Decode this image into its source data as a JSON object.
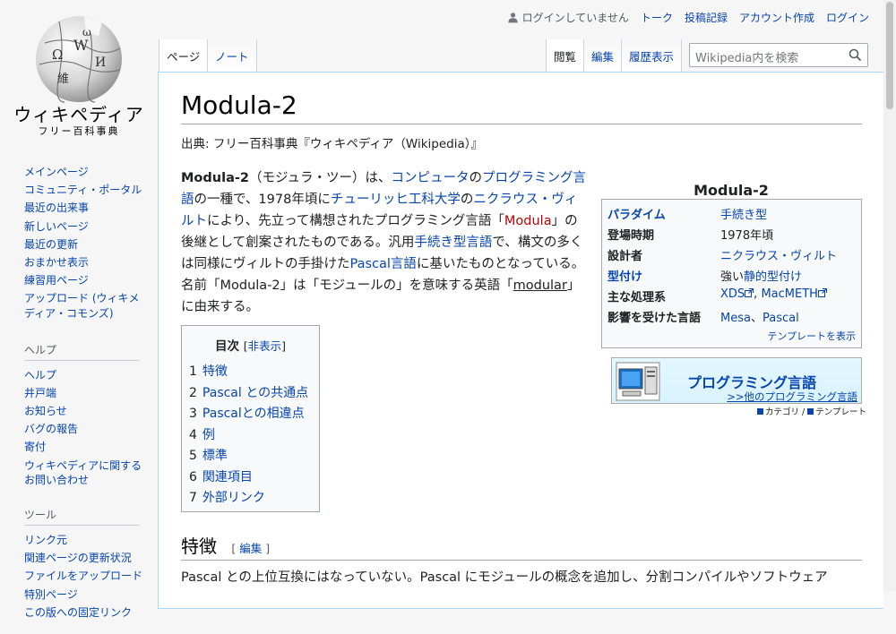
{
  "logo": {
    "name": "ウィキペディア",
    "tagline": "フリー百科事典"
  },
  "personal": {
    "status": "ログインしていません",
    "links": [
      "トーク",
      "投稿記録",
      "アカウント作成",
      "ログイン"
    ]
  },
  "tabs": {
    "left": [
      "ページ",
      "ノート"
    ],
    "right": [
      "閲覧",
      "編集",
      "履歴表示"
    ]
  },
  "search": {
    "placeholder": "Wikipedia内を検索"
  },
  "sidebar": {
    "nav": [
      "メインページ",
      "コミュニティ・ポータル",
      "最近の出来事",
      "新しいページ",
      "最近の更新",
      "おまかせ表示",
      "練習用ページ",
      "アップロード (ウィキメディア・コモンズ)"
    ],
    "help_heading": "ヘルプ",
    "help": [
      "ヘルプ",
      "井戸端",
      "お知らせ",
      "バグの報告",
      "寄付",
      "ウィキペディアに関するお問い合わせ"
    ],
    "tools_heading": "ツール",
    "tools": [
      "リンク元",
      "関連ページの更新状況",
      "ファイルをアップロード",
      "特別ページ",
      "この版への固定リンク"
    ]
  },
  "article": {
    "title": "Modula-2",
    "from": "出典: フリー百科事典『ウィキペディア（Wikipedia）』",
    "lead": {
      "t0": "Modula-2",
      "t1": "（モジュラ・ツー）は、",
      "l1": "コンピュータ",
      "t2": "の",
      "l2": "プログラミング言語",
      "t3": "の一種で、1978年頃に",
      "l3": "チューリッヒ工科大学",
      "t4": "の",
      "l4": "ニクラウス・ヴィルト",
      "t5": "により、先立って構想されたプログラミング言語「",
      "l5": "Modula",
      "t6": "」の後継として創案されたものである。汎用",
      "l6": "手続き型言語",
      "t7": "で、構文の多くは同様にヴィルトの手掛けた",
      "l7": "Pascal言語",
      "t8": "に基いたものとなっている。名前「Modula-2」は「モジュールの」を意味する英語「",
      "l8": "modular",
      "t9": "」に由来する。"
    },
    "toc": {
      "title": "目次",
      "toggle": "非表示",
      "items": [
        {
          "num": "1",
          "label": "特徴"
        },
        {
          "num": "2",
          "label": "Pascal との共通点"
        },
        {
          "num": "3",
          "label": "Pascalとの相違点"
        },
        {
          "num": "4",
          "label": "例"
        },
        {
          "num": "5",
          "label": "標準"
        },
        {
          "num": "6",
          "label": "関連項目"
        },
        {
          "num": "7",
          "label": "外部リンク"
        }
      ]
    },
    "section1": {
      "heading": "特徴",
      "edit": "編集",
      "text": "Pascal との上位互換にはなっていない。Pascal にモジュールの概念を追加し、分割コンパイルやソフトウェア"
    }
  },
  "infobox": {
    "caption": "Modula-2",
    "rows": [
      {
        "label": "パラダイム",
        "value": "手続き型"
      },
      {
        "label": "登場時期",
        "value": "1978年頃"
      },
      {
        "label": "設計者",
        "value": "ニクラウス・ヴィルト"
      },
      {
        "label": "型付け",
        "value_prefix": "強い",
        "value": "静的型付け"
      },
      {
        "label": "主な処理系",
        "value": "XDS",
        "value2": "MacMETH"
      },
      {
        "label": "影響を受けた言語",
        "value": "Mesa",
        "sep": "、",
        "value2": "Pascal"
      }
    ],
    "footer": "テンプレートを表示"
  },
  "portal": {
    "title": "プログラミング言語",
    "subtitle": ">>他のプログラミング言語",
    "category": "カテゴリ",
    "slash": " / ",
    "template": "テンプレート"
  },
  "colors": {
    "link": "#0645ad",
    "redlink": "#ba0000",
    "content_border": "#a7d7f9"
  }
}
